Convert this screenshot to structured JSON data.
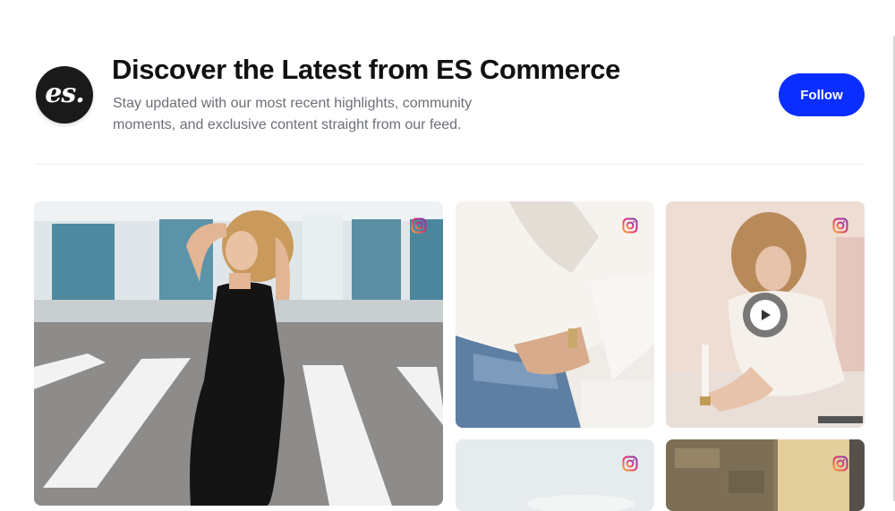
{
  "header": {
    "logo_text": "es.",
    "title": "Discover the Latest from ES Commerce",
    "subtitle": "Stay updated with our most recent highlights, community moments, and exclusive content straight from our feed.",
    "follow_label": "Follow"
  },
  "feed": {
    "posts": [
      {
        "icon": "instagram-icon",
        "media": "photo"
      },
      {
        "icon": "instagram-icon",
        "media": "photo"
      },
      {
        "icon": "instagram-icon",
        "media": "video"
      },
      {
        "icon": "instagram-icon",
        "media": "photo"
      },
      {
        "icon": "instagram-icon",
        "media": "photo"
      }
    ]
  },
  "colors": {
    "accent": "#0a2eff",
    "title": "#111111",
    "subtitle": "#6b6f76"
  }
}
